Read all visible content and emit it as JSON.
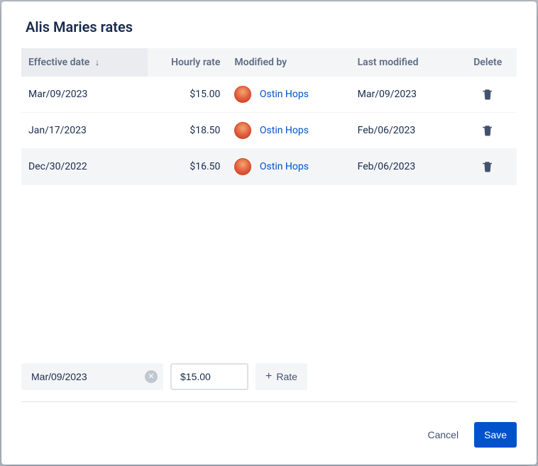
{
  "title": "Alis Maries rates",
  "columns": {
    "effective_date": "Effective date",
    "hourly_rate": "Hourly rate",
    "modified_by": "Modified by",
    "last_modified": "Last modified",
    "delete": "Delete"
  },
  "rows": [
    {
      "effective_date": "Mar/09/2023",
      "hourly_rate": "$15.00",
      "modified_by": "Ostin Hops",
      "last_modified": "Mar/09/2023"
    },
    {
      "effective_date": "Jan/17/2023",
      "hourly_rate": "$18.50",
      "modified_by": "Ostin Hops",
      "last_modified": "Feb/06/2023"
    },
    {
      "effective_date": "Dec/30/2022",
      "hourly_rate": "$16.50",
      "modified_by": "Ostin Hops",
      "last_modified": "Feb/06/2023"
    }
  ],
  "form": {
    "date_value": "Mar/09/2023",
    "rate_value": "$15.00",
    "add_label": "Rate"
  },
  "buttons": {
    "cancel": "Cancel",
    "save": "Save"
  }
}
